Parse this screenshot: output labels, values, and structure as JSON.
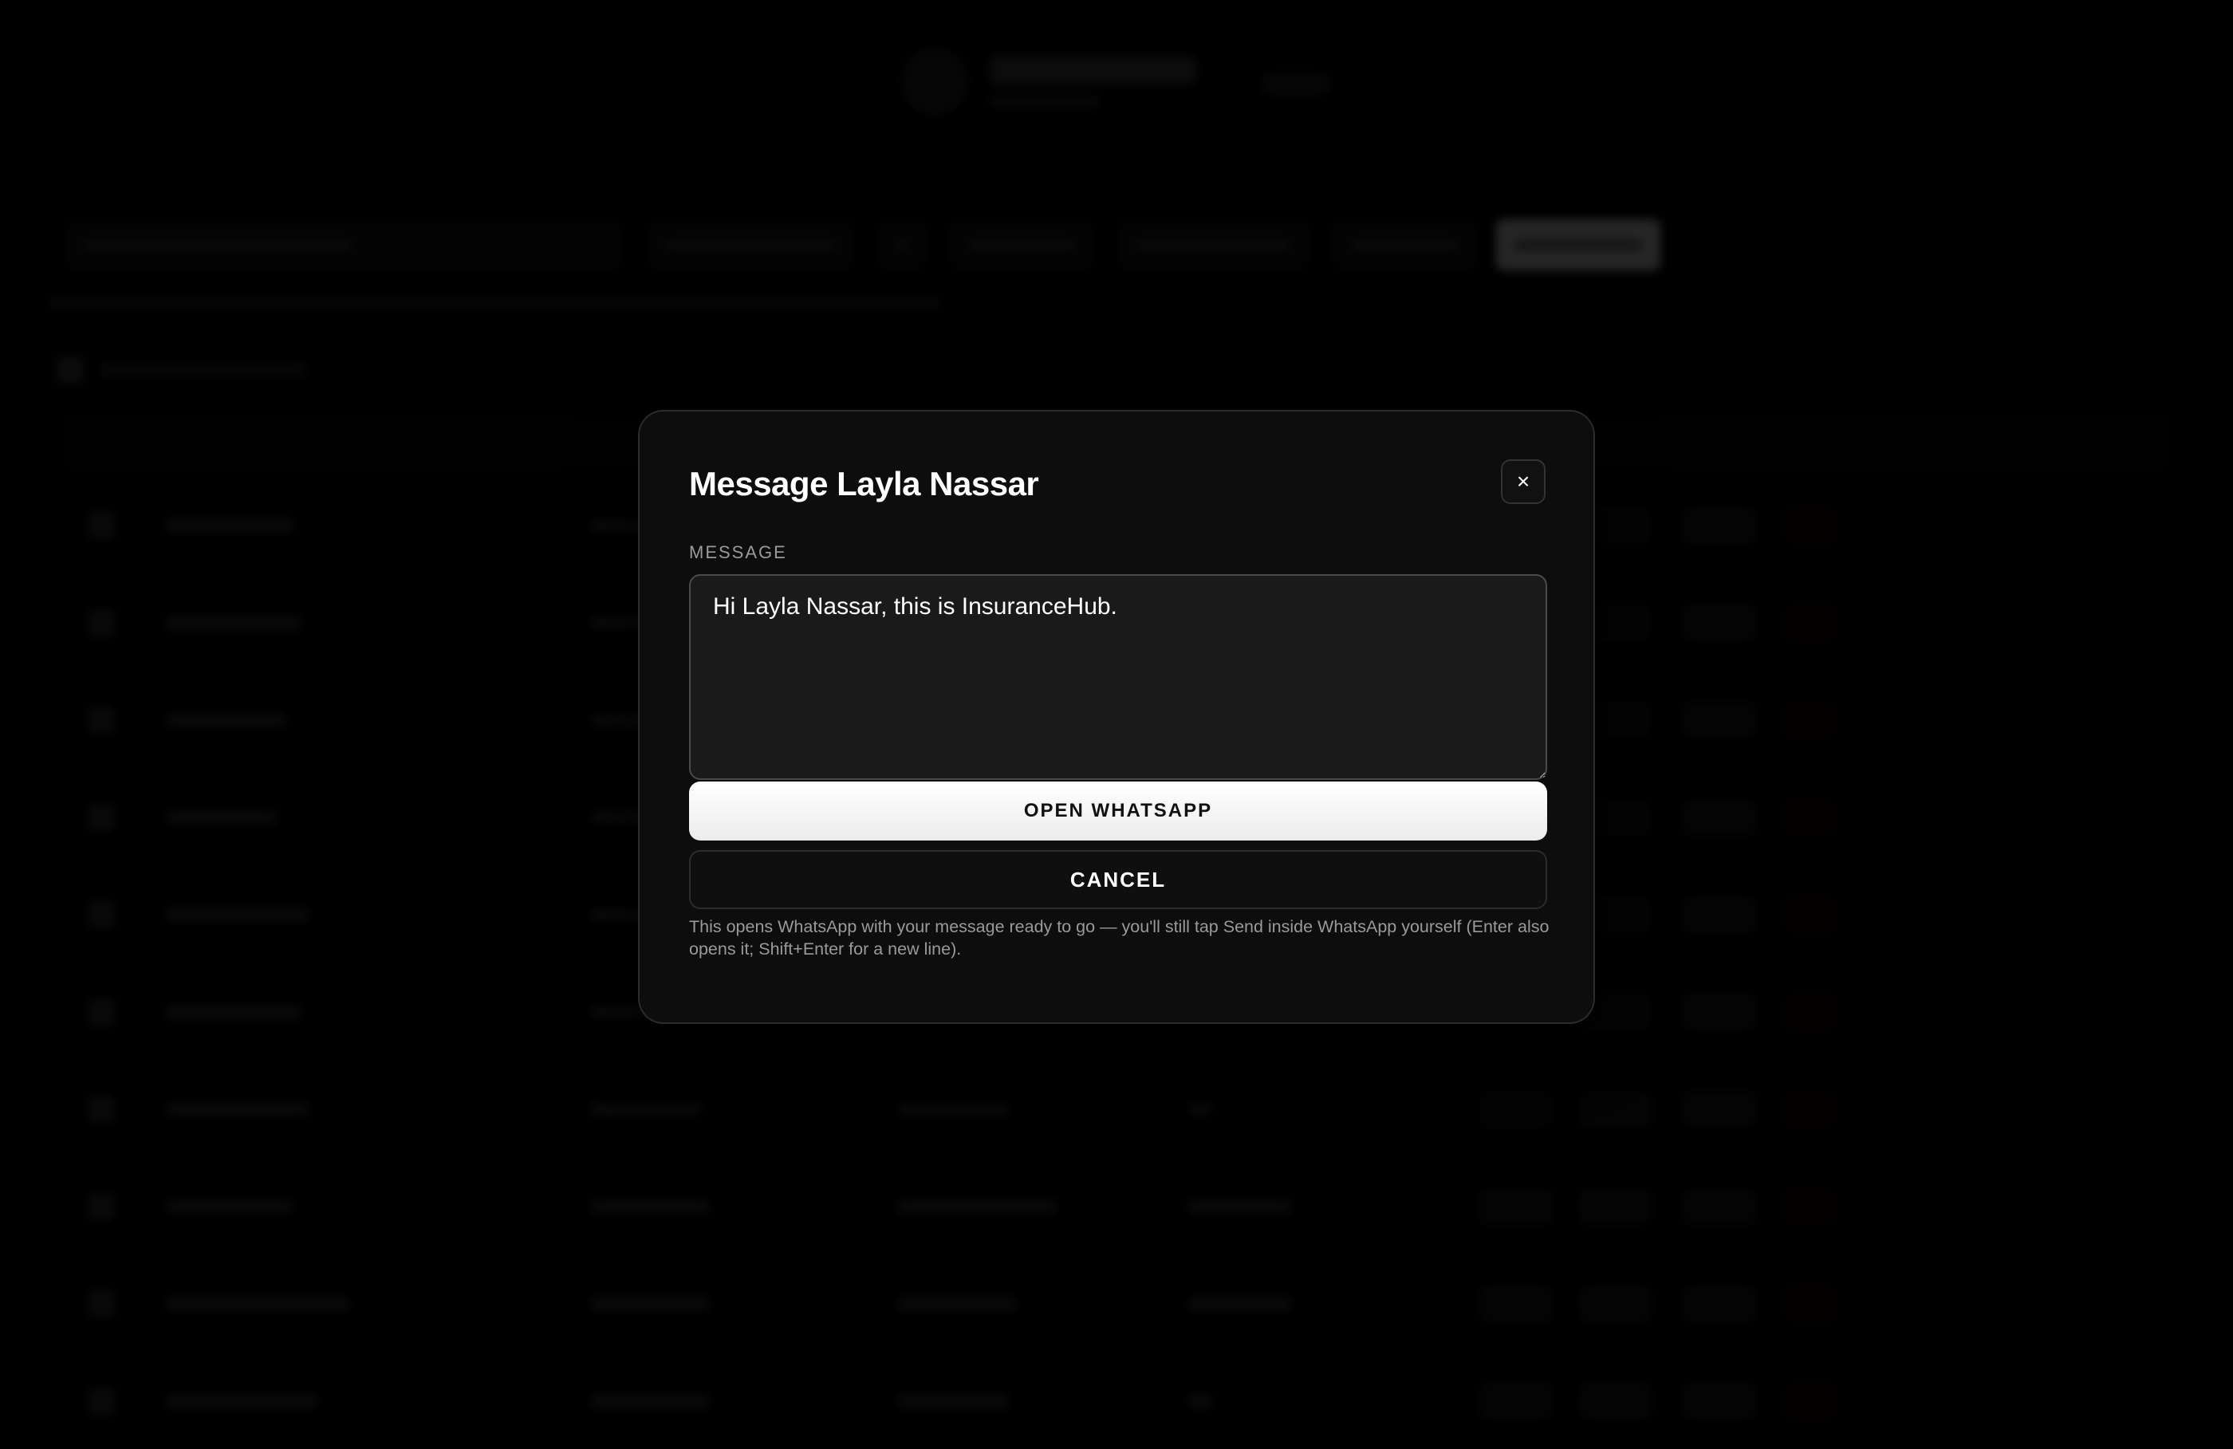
{
  "modal": {
    "title": "Message Layla Nassar",
    "close_label": "×",
    "field_label": "MESSAGE",
    "message_value": "Hi Layla Nassar, this is InsuranceHub.",
    "primary_button": "OPEN WHATSAPP",
    "secondary_button": "CANCEL",
    "hint": "This opens WhatsApp with your message ready to go — you'll still tap Send inside WhatsApp yourself (Enter also opens it; Shift+Enter for a new line)."
  },
  "colors": {
    "background": "#000000",
    "modal_bg": "#0d0d0d",
    "primary_button": "#ffffff",
    "delete_accent": "#5a1a1a"
  },
  "icons": {
    "close": "close-icon"
  }
}
